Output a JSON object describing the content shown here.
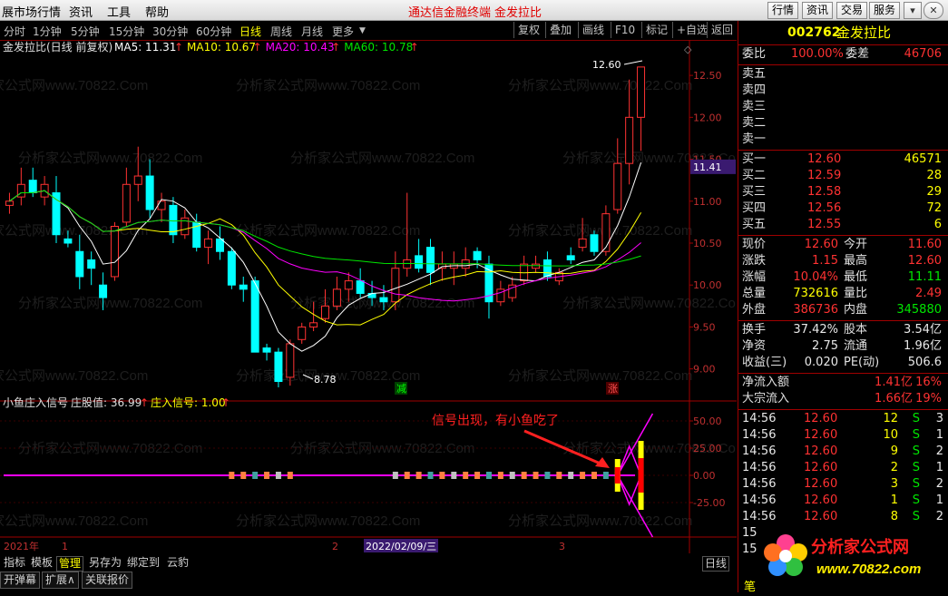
{
  "menubar": {
    "items": [
      "展市场行情",
      "资讯",
      "工具",
      "帮助"
    ],
    "title": "通达信金融终端",
    "stock_title": "金发拉比",
    "buttons": [
      "行情",
      "资讯",
      "交易",
      "服务"
    ]
  },
  "periods": {
    "items": [
      "分时",
      "1分钟",
      "5分钟",
      "15分钟",
      "30分钟",
      "60分钟",
      "日线",
      "周线",
      "月线",
      "更多"
    ],
    "active": "日线",
    "right_buttons": [
      "复权",
      "叠加",
      "画线",
      "F10",
      "标记",
      "+自选",
      "返回"
    ]
  },
  "main_chart": {
    "legend_name": "金发拉比(日线 前复权)",
    "ma": [
      {
        "label": "MA5: 11.31",
        "color": "#ffffff"
      },
      {
        "label": "MA10: 10.67",
        "color": "#ffff00"
      },
      {
        "label": "MA20: 10.43",
        "color": "#ff00ff"
      },
      {
        "label": "MA60: 10.78",
        "color": "#00e600"
      }
    ],
    "high_label": "12.60",
    "low_label": "8.78",
    "current_price": "11.41",
    "marker_jian": "减",
    "marker_zhang": "涨",
    "yticks": [
      "12.50",
      "12.00",
      "11.50",
      "11.00",
      "10.50",
      "10.00",
      "9.50",
      "9.00"
    ]
  },
  "indicator": {
    "name": "小鱼庄入信号",
    "v1": "庄股值: 36.99",
    "v2": "庄入信号: 1.00",
    "annotation": "信号出现，有小鱼吃了",
    "yticks": [
      "50.00",
      "25.00",
      "0.00",
      "-25.00"
    ]
  },
  "xaxis": {
    "labels": [
      "2021年",
      "1",
      "2",
      "2022/02/09/三",
      "3"
    ]
  },
  "watermark": "分析家公式网www.70822.Com",
  "chart_data": {
    "type": "candlestick",
    "ylim": [
      8.65,
      12.75
    ],
    "candles": [
      [
        10.95,
        11.1,
        10.85,
        11.0
      ],
      [
        11.05,
        11.4,
        10.95,
        11.2
      ],
      [
        11.25,
        11.4,
        11.05,
        11.1
      ],
      [
        11.05,
        11.3,
        10.95,
        11.2
      ],
      [
        11.1,
        11.3,
        10.5,
        10.6
      ],
      [
        10.55,
        10.65,
        10.45,
        10.5
      ],
      [
        10.4,
        10.6,
        9.95,
        10.1
      ],
      [
        10.3,
        10.4,
        10.0,
        10.2
      ],
      [
        10.0,
        10.15,
        9.7,
        9.85
      ],
      [
        10.1,
        10.75,
        10.05,
        10.7
      ],
      [
        10.75,
        11.4,
        10.7,
        11.2
      ],
      [
        11.2,
        11.65,
        11.0,
        11.3
      ],
      [
        11.3,
        11.5,
        10.8,
        10.9
      ],
      [
        10.9,
        11.1,
        10.75,
        11.0
      ],
      [
        10.95,
        11.05,
        10.5,
        10.6
      ],
      [
        10.6,
        10.9,
        10.55,
        10.8
      ],
      [
        10.75,
        10.85,
        10.4,
        10.45
      ],
      [
        10.45,
        10.65,
        10.25,
        10.55
      ],
      [
        10.55,
        10.7,
        10.3,
        10.4
      ],
      [
        10.4,
        10.45,
        9.95,
        10.0
      ],
      [
        10.0,
        10.1,
        9.8,
        9.95
      ],
      [
        10.05,
        10.1,
        9.2,
        9.2
      ],
      [
        9.25,
        9.3,
        9.1,
        9.2
      ],
      [
        9.2,
        9.25,
        8.78,
        8.85
      ],
      [
        8.9,
        9.35,
        8.8,
        9.3
      ],
      [
        9.35,
        9.55,
        9.3,
        9.5
      ],
      [
        9.5,
        9.8,
        9.45,
        9.55
      ],
      [
        9.6,
        9.95,
        9.55,
        9.75
      ],
      [
        9.75,
        10.1,
        9.7,
        9.95
      ],
      [
        9.95,
        10.15,
        9.8,
        10.05
      ],
      [
        10.05,
        10.2,
        9.85,
        9.9
      ],
      [
        9.9,
        10.05,
        9.75,
        9.85
      ],
      [
        9.85,
        10.0,
        9.7,
        9.8
      ],
      [
        9.8,
        10.4,
        9.7,
        10.2
      ],
      [
        10.2,
        11.1,
        10.1,
        10.3
      ],
      [
        10.35,
        10.55,
        10.15,
        10.2
      ],
      [
        10.45,
        10.55,
        10.0,
        10.15
      ],
      [
        10.2,
        10.4,
        10.05,
        10.25
      ],
      [
        10.2,
        10.4,
        10.0,
        10.25
      ],
      [
        10.2,
        10.45,
        10.1,
        10.3
      ],
      [
        10.4,
        10.45,
        10.2,
        10.3
      ],
      [
        10.25,
        10.35,
        9.6,
        9.8
      ],
      [
        9.8,
        10.05,
        9.75,
        9.95
      ],
      [
        9.85,
        10.1,
        9.8,
        10.0
      ],
      [
        10.05,
        10.35,
        10.0,
        10.25
      ],
      [
        10.2,
        10.35,
        10.15,
        10.25
      ],
      [
        10.3,
        10.4,
        10.05,
        10.1
      ],
      [
        10.05,
        10.2,
        10.0,
        10.15
      ],
      [
        10.35,
        10.45,
        10.25,
        10.3
      ],
      [
        10.45,
        10.8,
        10.4,
        10.55
      ],
      [
        10.6,
        10.65,
        10.35,
        10.4
      ],
      [
        10.4,
        10.95,
        10.35,
        10.85
      ],
      [
        10.9,
        11.75,
        10.85,
        11.45
      ],
      [
        11.45,
        12.45,
        11.2,
        12.0
      ],
      [
        12.0,
        12.6,
        11.6,
        12.6
      ]
    ],
    "ma": {
      "MA5": "#ffffff",
      "MA10": "#ffff00",
      "MA20": "#ff00ff",
      "MA60": "#00e600"
    }
  },
  "quote": {
    "code": "002762",
    "name": "金发拉比",
    "weibi_label": "委比",
    "weibi": "100.00%",
    "weicha_label": "委差",
    "weicha": "46706",
    "sells": [
      {
        "l": "卖五",
        "p": "",
        "v": ""
      },
      {
        "l": "卖四",
        "p": "",
        "v": ""
      },
      {
        "l": "卖三",
        "p": "",
        "v": ""
      },
      {
        "l": "卖二",
        "p": "",
        "v": ""
      },
      {
        "l": "卖一",
        "p": "",
        "v": ""
      }
    ],
    "buys": [
      {
        "l": "买一",
        "p": "12.60",
        "v": "46571"
      },
      {
        "l": "买二",
        "p": "12.59",
        "v": "28"
      },
      {
        "l": "买三",
        "p": "12.58",
        "v": "29"
      },
      {
        "l": "买四",
        "p": "12.56",
        "v": "72"
      },
      {
        "l": "买五",
        "p": "12.55",
        "v": "6"
      }
    ],
    "stats": [
      {
        "a": "现价",
        "av": "12.60",
        "ac": "r",
        "b": "今开",
        "bv": "11.60",
        "bc": "r"
      },
      {
        "a": "涨跌",
        "av": "1.15",
        "ac": "r",
        "b": "最高",
        "bv": "12.60",
        "bc": "r"
      },
      {
        "a": "涨幅",
        "av": "10.04%",
        "ac": "r",
        "b": "最低",
        "bv": "11.11",
        "bc": "g"
      },
      {
        "a": "总量",
        "av": "732616",
        "ac": "y",
        "b": "量比",
        "bv": "2.49",
        "bc": "r"
      },
      {
        "a": "外盘",
        "av": "386736",
        "ac": "r",
        "b": "内盘",
        "bv": "345880",
        "bc": "g"
      }
    ],
    "stats2": [
      {
        "a": "换手",
        "av": "37.42%",
        "ac": "w",
        "b": "股本",
        "bv": "3.54亿",
        "bc": "w"
      },
      {
        "a": "净资",
        "av": "2.75",
        "ac": "w",
        "b": "流通",
        "bv": "1.96亿",
        "bc": "w"
      },
      {
        "a": "收益(三)",
        "av": "0.020",
        "ac": "w",
        "b": "PE(动)",
        "bv": "506.6",
        "bc": "w"
      }
    ],
    "flows": [
      {
        "l": "净流入额",
        "v": "1.41亿",
        "p": "16%"
      },
      {
        "l": "大宗流入",
        "v": "1.66亿",
        "p": "19%"
      }
    ],
    "ticks": [
      {
        "t": "14:56",
        "p": "12.60",
        "v": "12",
        "s": "S",
        "n": "3"
      },
      {
        "t": "14:56",
        "p": "12.60",
        "v": "10",
        "s": "S",
        "n": "1"
      },
      {
        "t": "14:56",
        "p": "12.60",
        "v": "9",
        "s": "S",
        "n": "2"
      },
      {
        "t": "14:56",
        "p": "12.60",
        "v": "2",
        "s": "S",
        "n": "1"
      },
      {
        "t": "14:56",
        "p": "12.60",
        "v": "3",
        "s": "S",
        "n": "2"
      },
      {
        "t": "14:56",
        "p": "12.60",
        "v": "1",
        "s": "S",
        "n": "1"
      },
      {
        "t": "14:56",
        "p": "12.60",
        "v": "8",
        "s": "S",
        "n": "2"
      },
      {
        "t": "15",
        "p": "",
        "v": "",
        "s": "",
        "n": ""
      },
      {
        "t": "15",
        "p": "",
        "v": "",
        "s": "",
        "n": ""
      }
    ],
    "bottom_tab": "笔",
    "logo_text": "分析家公式网",
    "logo_url": "www.70822.com"
  },
  "bottom": {
    "tabs": [
      "指标",
      "模板",
      "管理",
      "另存为",
      "绑定到",
      "云豹"
    ],
    "active": "管理",
    "row2": [
      "开弹幕",
      "扩展∧",
      "关联报价"
    ],
    "right_label": "日线"
  }
}
